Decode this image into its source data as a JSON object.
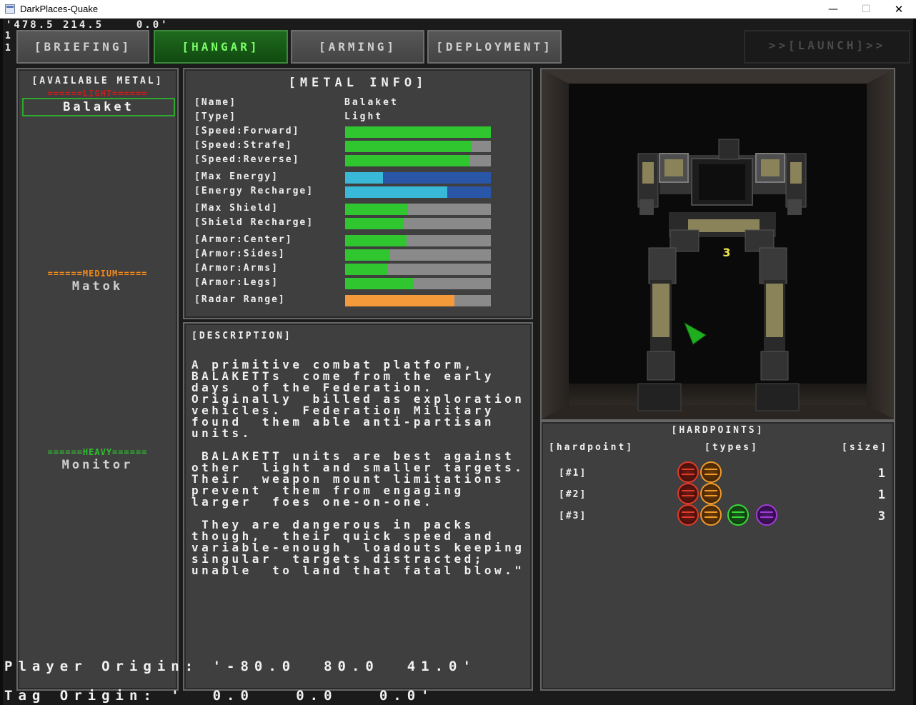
{
  "window": {
    "title": "DarkPlaces-Quake",
    "minimize": "—",
    "maximize": "☐",
    "close": "✕"
  },
  "debug": {
    "coords": "'478.5 214.5    0.0'",
    "line1": "1",
    "line2": "1"
  },
  "tabs": [
    {
      "label": "[BRIEFING]",
      "state": "normal"
    },
    {
      "label": "[HANGAR]",
      "state": "active"
    },
    {
      "label": "[ARMING]",
      "state": "normal"
    },
    {
      "label": "[DEPLOYMENT]",
      "state": "normal"
    },
    {
      "label": ">>[LAUNCH]>>",
      "state": "disabled"
    }
  ],
  "available": {
    "title": "[AVAILABLE METAL]",
    "categories": [
      {
        "label": "======LIGHT======",
        "color": "#c81d1d",
        "metals": [
          "Balaket"
        ]
      },
      {
        "label": "======MEDIUM=====",
        "color": "#f08a1c",
        "metals": [
          "Matok"
        ]
      },
      {
        "label": "======HEAVY======",
        "color": "#2fbf2f",
        "metals": [
          "Monitor"
        ]
      }
    ],
    "selected": "Balaket"
  },
  "metal_info": {
    "title": "[METAL INFO]",
    "name_label": "[Name]",
    "name_value": "Balaket",
    "type_label": "[Type]",
    "type_value": "Light",
    "stats": [
      {
        "label": "[Speed:Forward]",
        "value": 1.0,
        "color": "#2fc62f"
      },
      {
        "label": "[Speed:Strafe]",
        "value": 0.87,
        "color": "#2fc62f"
      },
      {
        "label": "[Speed:Reverse]",
        "value": 0.86,
        "color": "#2fc62f"
      },
      {
        "label": "[Max Energy]",
        "value": 0.26,
        "color": "#3ab8d8",
        "track": "#2a56a8"
      },
      {
        "label": "[Energy Recharge]",
        "value": 0.7,
        "color": "#3ab8d8",
        "track": "#2a56a8"
      },
      {
        "label": "[Max Shield]",
        "value": 0.43,
        "color": "#2fc62f"
      },
      {
        "label": "[Shield Recharge]",
        "value": 0.4,
        "color": "#2fc62f"
      },
      {
        "label": "[Armor:Center]",
        "value": 0.42,
        "color": "#2fc62f"
      },
      {
        "label": "[Armor:Sides]",
        "value": 0.31,
        "color": "#2fc62f"
      },
      {
        "label": "[Armor:Arms]",
        "value": 0.29,
        "color": "#2fc62f"
      },
      {
        "label": "[Armor:Legs]",
        "value": 0.47,
        "color": "#2fc62f"
      },
      {
        "label": "[Radar Range]",
        "value": 0.75,
        "color": "#f59a3a"
      }
    ]
  },
  "description": {
    "title": "[DESCRIPTION]",
    "paragraphs": [
      "A primitive combat platform,\nBALAKETTs  come from the early\ndays  of the Federation.\nOriginally  billed as exploration\nvehicles.  Federation Military\nfound  them able anti-partisan\nunits.",
      " BALAKETT units are best against\nother  light and smaller targets.\nTheir  weapon mount limitations\nprevent  them from engaging\nlarger  foes one-on-one.",
      " They are dangerous in packs\nthough,  their quick speed and\nvariable-enough  loadouts keeping\nsingular  targets distracted;\nunable  to land that fatal blow.\""
    ]
  },
  "viewport": {
    "marker": "3"
  },
  "hardpoints": {
    "title": "[HARDPOINTS]",
    "col_hardpoint": "[hardpoint]",
    "col_types": "[types]",
    "col_size": "[size]",
    "rows": [
      {
        "label": "[#1]",
        "types": [
          "red-weapon",
          "orange-weapon"
        ],
        "size": "1"
      },
      {
        "label": "[#2]",
        "types": [
          "red-weapon",
          "orange-weapon"
        ],
        "size": "1"
      },
      {
        "label": "[#3]",
        "types": [
          "red-weapon",
          "orange-weapon",
          "green-weapon",
          "purple-weapon"
        ],
        "size": "3"
      }
    ]
  },
  "bottom": {
    "player_origin": "Player Origin: '-80.0  80.0  41.0'",
    "tag_origin": "Tag Origin: '  0.0   0.0   0.0'"
  }
}
